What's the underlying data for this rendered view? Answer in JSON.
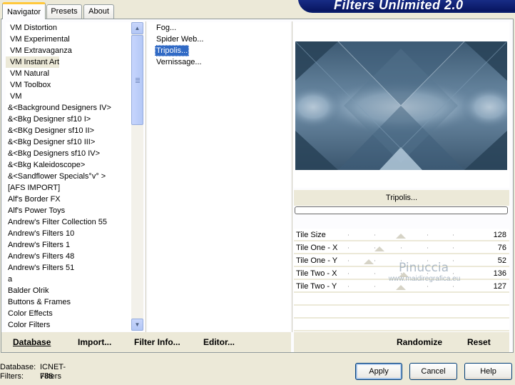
{
  "tabs": [
    {
      "label": "Navigator",
      "active": true
    },
    {
      "label": "Presets",
      "active": false
    },
    {
      "label": "About",
      "active": false
    }
  ],
  "app_title": "Filters Unlimited 2.0",
  "categories": [
    "VM Distortion",
    "VM Experimental",
    "VM Extravaganza",
    "VM Instant Art",
    "VM Natural",
    "VM Toolbox",
    "VM",
    "&<Background Designers IV>",
    "&<Bkg Designer sf10 I>",
    "&<BKg Designer sf10 II>",
    "&<Bkg Designer sf10 III>",
    "&<Bkg Designers sf10 IV>",
    "&<Bkg Kaleidoscope>",
    "&<Sandflower Specials°v° >",
    "[AFS IMPORT]",
    "Alf's Border FX",
    "Alf's Power Toys",
    "Andrew's Filter Collection 55",
    "Andrew's Filters 10",
    "Andrew's Filters 1",
    "Andrew's Filters 48",
    "Andrew's Filters 51",
    "a",
    "Balder Olrik",
    "Buttons & Frames",
    "Color Effects",
    "Color Filters"
  ],
  "selected_category_index": 3,
  "filters": [
    "Fog...",
    "Spider Web...",
    "Tripolis...",
    "Vernissage..."
  ],
  "selected_filter_index": 2,
  "current_filter_name": "Tripolis...",
  "parameters": [
    {
      "label": "Tile Size",
      "value": "128",
      "level": 0.5
    },
    {
      "label": "Tile One - X",
      "value": "76",
      "level": 0.3
    },
    {
      "label": "Tile One - Y",
      "value": "52",
      "level": 0.2
    },
    {
      "label": "Tile Two - X",
      "value": "136",
      "level": 0.53
    },
    {
      "label": "Tile Two - Y",
      "value": "127",
      "level": 0.5
    }
  ],
  "watermark": {
    "name": "Pinuccia",
    "url": "www.maidiregrafica.eu"
  },
  "left_buttons": {
    "database": "Database",
    "import": "Import...",
    "filter_info": "Filter Info...",
    "editor": "Editor..."
  },
  "right_buttons": {
    "randomize": "Randomize",
    "reset": "Reset"
  },
  "status": {
    "database_label": "Database:",
    "database_value": "ICNET-Filters",
    "filters_label": "Filters:",
    "filters_value": "788"
  },
  "dialog_buttons": {
    "apply": "Apply",
    "cancel": "Cancel",
    "help": "Help"
  }
}
